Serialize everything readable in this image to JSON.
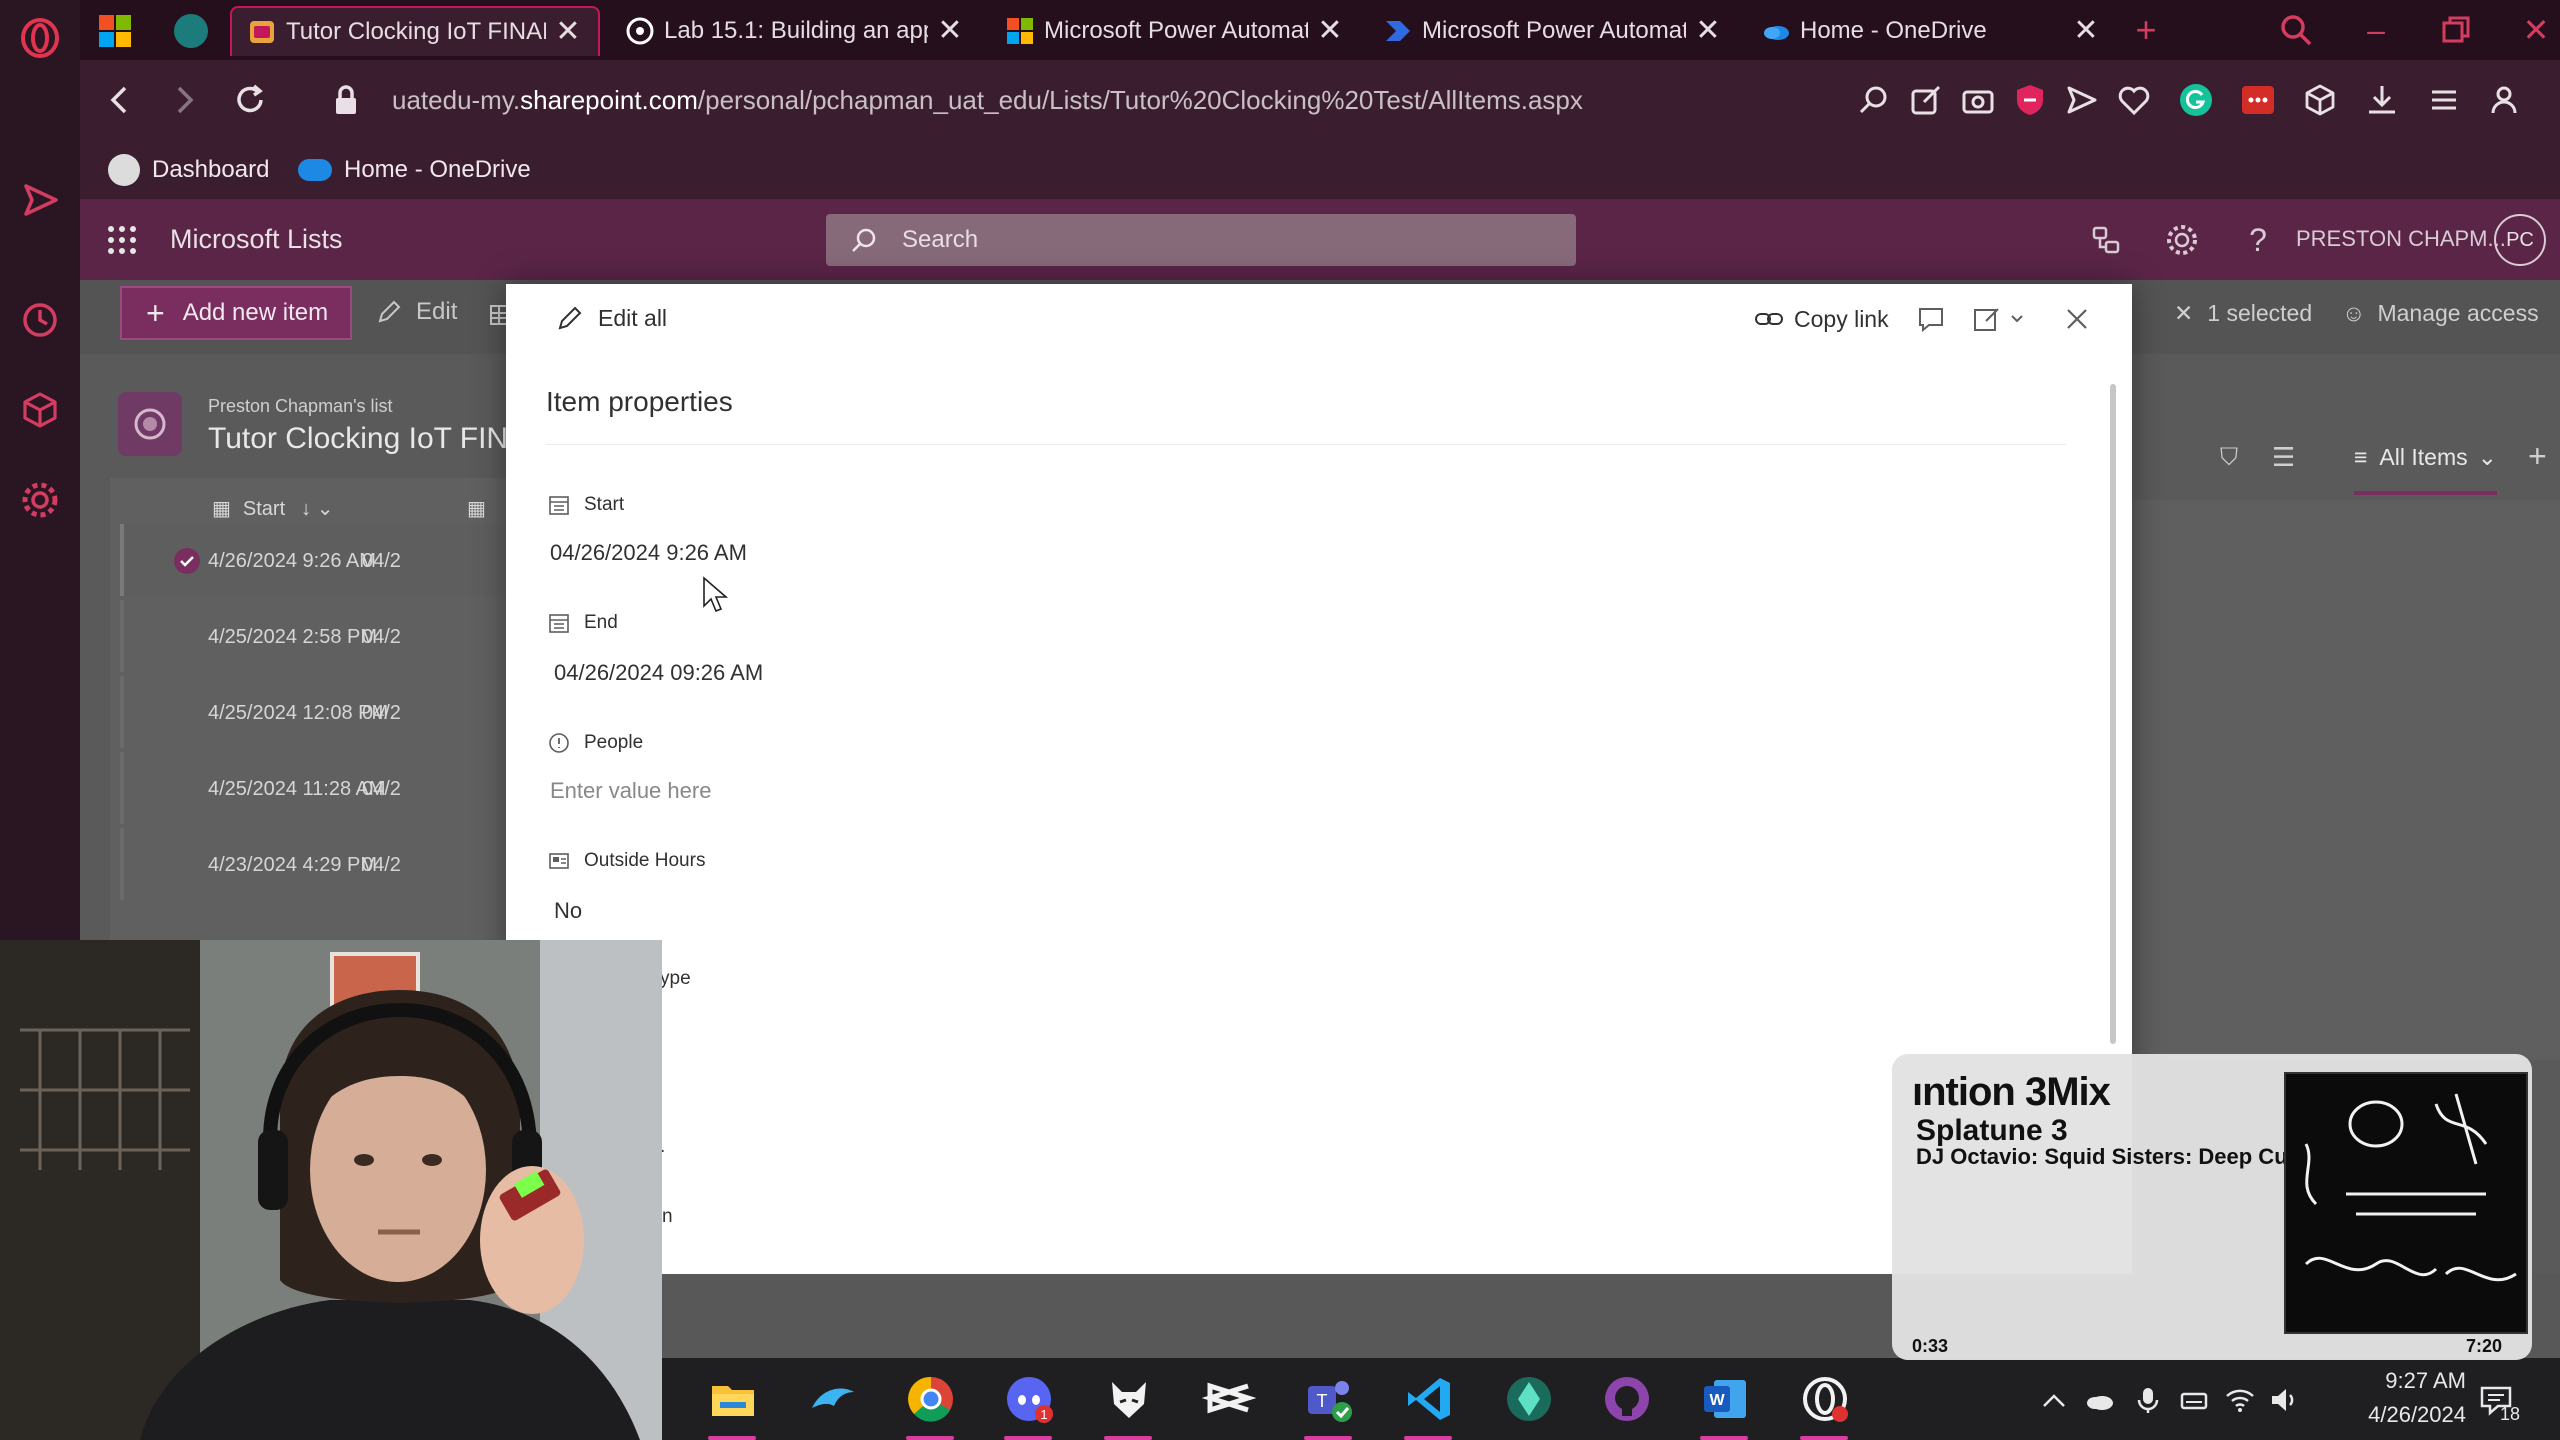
{
  "browser": {
    "tabs": [
      {
        "label": "Tutor Clocking IoT FINAL",
        "active": true
      },
      {
        "label": "Lab 15.1: Building an app",
        "active": false
      },
      {
        "label": "Microsoft Power Automat",
        "active": false
      },
      {
        "label": "Microsoft Power Automat",
        "active": false
      },
      {
        "label": "Home - OneDrive",
        "active": false
      }
    ],
    "url_prefix": "uatedu-my.",
    "url_domain": "sharepoint.com",
    "url_path": "/personal/pchapman_uat_edu/Lists/Tutor%20Clocking%20Test/AllItems.aspx",
    "bookmarks": [
      {
        "label": "Dashboard"
      },
      {
        "label": "Home - OneDrive"
      }
    ]
  },
  "sharepoint": {
    "app_name": "Microsoft Lists",
    "search_placeholder": "Search",
    "user_name": "PRESTON CHAPM...",
    "user_initials": "PC",
    "commands": {
      "add_new_item": "Add new item",
      "edit": "Edit",
      "selected_count": "1 selected",
      "manage_access": "Manage access"
    },
    "list": {
      "owner": "Preston Chapman's list",
      "title": "Tutor Clocking IoT FINA",
      "view_name": "All Items",
      "column_start": "Start",
      "rows": [
        {
          "start": "4/26/2024 9:26 AM",
          "end": "04/2",
          "selected": true
        },
        {
          "start": "4/25/2024 2:58 PM",
          "end": "04/2",
          "selected": false
        },
        {
          "start": "4/25/2024 12:08 PM",
          "end": "04/2",
          "selected": false
        },
        {
          "start": "4/25/2024 11:28 AM",
          "end": "04/2",
          "selected": false
        },
        {
          "start": "4/23/2024 4:29 PM",
          "end": "04/2",
          "selected": false
        }
      ]
    }
  },
  "panel": {
    "edit_all": "Edit all",
    "copy_link": "Copy link",
    "title": "Item properties",
    "fields": [
      {
        "label": "Start",
        "value": "04/26/2024 9:26 AM",
        "placeholder": false
      },
      {
        "label": "End",
        "value": "04/26/2024 09:26 AM",
        "placeholder": false
      },
      {
        "label": "People",
        "value": "Enter value here",
        "placeholder": true
      },
      {
        "label": "Outside Hours",
        "value": "No",
        "placeholder": false
      }
    ],
    "partial_labels": [
      "ype",
      ".",
      "n"
    ]
  },
  "music": {
    "title": "ıntion 3Mix",
    "artist": "Splatune 3",
    "track": "DJ Octavio: Squid Sisters: Deep Cut",
    "current_time": "0:33",
    "duration": "7:20",
    "progress": 0.075
  },
  "taskbar": {
    "time": "9:27 AM",
    "date": "4/26/2024",
    "notifications": "18",
    "apps": [
      "file-explorer",
      "edge-dolphin",
      "chrome",
      "discord",
      "firefox-fox",
      "capcut",
      "teams",
      "vscode",
      "gem-app",
      "github",
      "word",
      "opera-gx"
    ]
  },
  "colors": {
    "brand_purple": "#5b2548",
    "opera_red": "#d43c60",
    "tab_active_border": "#c2185b",
    "accent_button": "#7a2e5f"
  }
}
